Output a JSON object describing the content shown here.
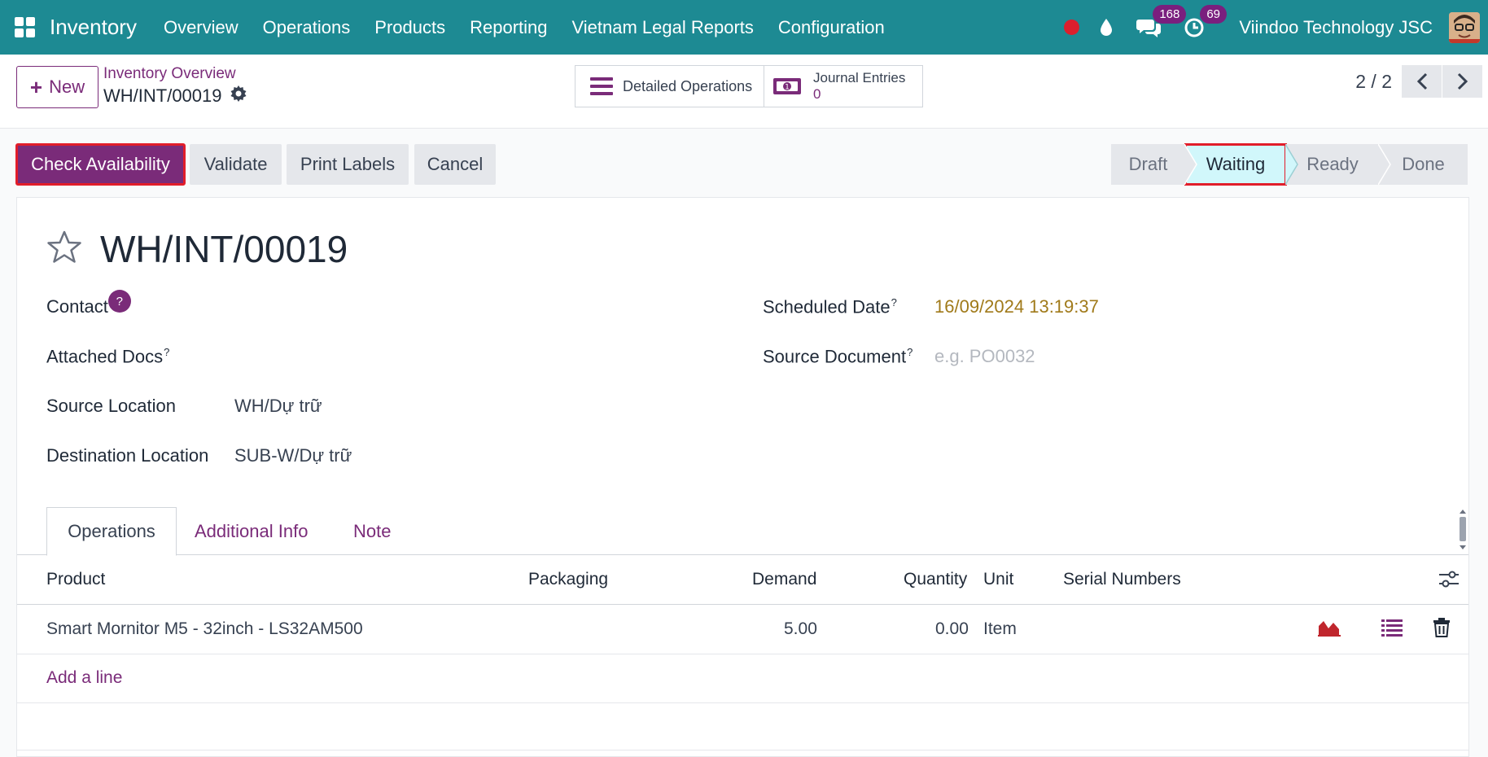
{
  "nav": {
    "app_name": "Inventory",
    "menu": [
      "Overview",
      "Operations",
      "Products",
      "Reporting",
      "Vietnam Legal Reports",
      "Configuration"
    ],
    "messages_count": "168",
    "activities_count": "69",
    "company": "Viindoo Technology JSC"
  },
  "control": {
    "new_label": "New",
    "breadcrumb_parent": "Inventory Overview",
    "breadcrumb_current": "WH/INT/00019",
    "smart_operations_label": "Detailed Operations",
    "smart_journal_label": "Journal Entries",
    "smart_journal_count": "0",
    "pager": "2 / 2"
  },
  "actions": {
    "check_availability": "Check Availability",
    "validate": "Validate",
    "print_labels": "Print Labels",
    "cancel": "Cancel"
  },
  "stages": [
    "Draft",
    "Waiting",
    "Ready",
    "Done"
  ],
  "active_stage": "Waiting",
  "form": {
    "title": "WH/INT/00019",
    "contact_label": "Contact",
    "contact_help": "?",
    "attached_docs_label": "Attached Docs",
    "source_location_label": "Source Location",
    "source_location_value": "WH/Dự trữ",
    "destination_location_label": "Destination Location",
    "destination_location_value": "SUB-W/Dự trữ",
    "scheduled_date_label": "Scheduled Date",
    "scheduled_date_value": "16/09/2024 13:19:37",
    "source_document_label": "Source Document",
    "source_document_placeholder": "e.g. PO0032",
    "help_mark": "?"
  },
  "tabs": [
    "Operations",
    "Additional Info",
    "Note"
  ],
  "table": {
    "headers": {
      "product": "Product",
      "packaging": "Packaging",
      "demand": "Demand",
      "quantity": "Quantity",
      "unit": "Unit",
      "serials": "Serial Numbers"
    },
    "rows": [
      {
        "product": "Smart Mornitor M5 - 32inch - LS32AM500",
        "packaging": "",
        "demand": "5.00",
        "quantity": "0.00",
        "unit": "Item"
      }
    ],
    "add_line": "Add a line"
  },
  "colors": {
    "navbar": "#1d8a93",
    "primary": "#7a2b79",
    "highlight": "#e11d2a",
    "active_stage_bg": "#d1f7fb"
  }
}
